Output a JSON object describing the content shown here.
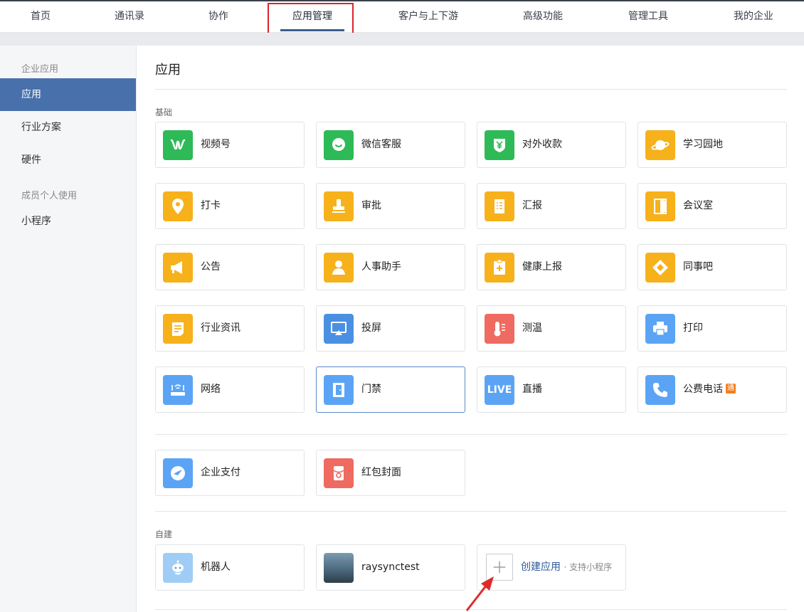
{
  "nav": {
    "items": [
      {
        "label": "首页"
      },
      {
        "label": "通讯录"
      },
      {
        "label": "协作"
      },
      {
        "label": "应用管理"
      },
      {
        "label": "客户与上下游"
      },
      {
        "label": "高级功能"
      },
      {
        "label": "管理工具"
      },
      {
        "label": "我的企业"
      }
    ],
    "active": "应用管理"
  },
  "sidebar": {
    "group1": "企业应用",
    "items1": [
      {
        "label": "应用"
      },
      {
        "label": "行业方案"
      },
      {
        "label": "硬件"
      }
    ],
    "group2": "成员个人使用",
    "items2": [
      {
        "label": "小程序"
      }
    ]
  },
  "main": {
    "title": "应用",
    "basic_label": "基础",
    "basic": [
      {
        "label": "视频号",
        "icon": "video-channel-icon",
        "color": "#2dba57"
      },
      {
        "label": "微信客服",
        "icon": "chat-bubble-icon",
        "color": "#2dba57"
      },
      {
        "label": "对外收款",
        "icon": "yuan-shield-icon",
        "color": "#2dba57"
      },
      {
        "label": "学习园地",
        "icon": "planet-icon",
        "color": "#f6b11b"
      },
      {
        "label": "打卡",
        "icon": "location-pin-icon",
        "color": "#f6b11b"
      },
      {
        "label": "审批",
        "icon": "stamp-icon",
        "color": "#f6b11b"
      },
      {
        "label": "汇报",
        "icon": "report-doc-icon",
        "color": "#f6b11b"
      },
      {
        "label": "会议室",
        "icon": "door-icon",
        "color": "#f6b11b"
      },
      {
        "label": "公告",
        "icon": "megaphone-icon",
        "color": "#f6b11b"
      },
      {
        "label": "人事助手",
        "icon": "person-icon",
        "color": "#f6b11b"
      },
      {
        "label": "健康上报",
        "icon": "health-clipboard-icon",
        "color": "#f6b11b"
      },
      {
        "label": "同事吧",
        "icon": "diamond-icon",
        "color": "#f6b11b"
      },
      {
        "label": "行业资讯",
        "icon": "news-icon",
        "color": "#f6b11b"
      },
      {
        "label": "投屏",
        "icon": "screen-cast-icon",
        "color": "#4a90e2"
      },
      {
        "label": "测温",
        "icon": "thermometer-icon",
        "color": "#ef6a60"
      },
      {
        "label": "打印",
        "icon": "printer-icon",
        "color": "#4a90e2"
      },
      {
        "label": "网络",
        "icon": "router-icon",
        "color": "#4a90e2"
      },
      {
        "label": "门禁",
        "icon": "door-access-icon",
        "color": "#4a90e2"
      },
      {
        "label": "直播",
        "icon": "live-icon",
        "color": "#4a90e2"
      },
      {
        "label": "公费电话",
        "icon": "phone-icon",
        "color": "#4a90e2",
        "badge": "通"
      }
    ],
    "finance": [
      {
        "label": "企业支付",
        "icon": "payment-icon",
        "color": "#4a90e2"
      },
      {
        "label": "红包封面",
        "icon": "red-envelope-icon",
        "color": "#ef6a60"
      }
    ],
    "custom_label": "自建",
    "custom": [
      {
        "label": "机器人",
        "icon": "robot-avatar-icon"
      },
      {
        "label": "raysynctest",
        "icon": "photo-thumbnail-icon"
      }
    ],
    "create": {
      "label": "创建应用",
      "sub": "· 支持小程序"
    }
  }
}
